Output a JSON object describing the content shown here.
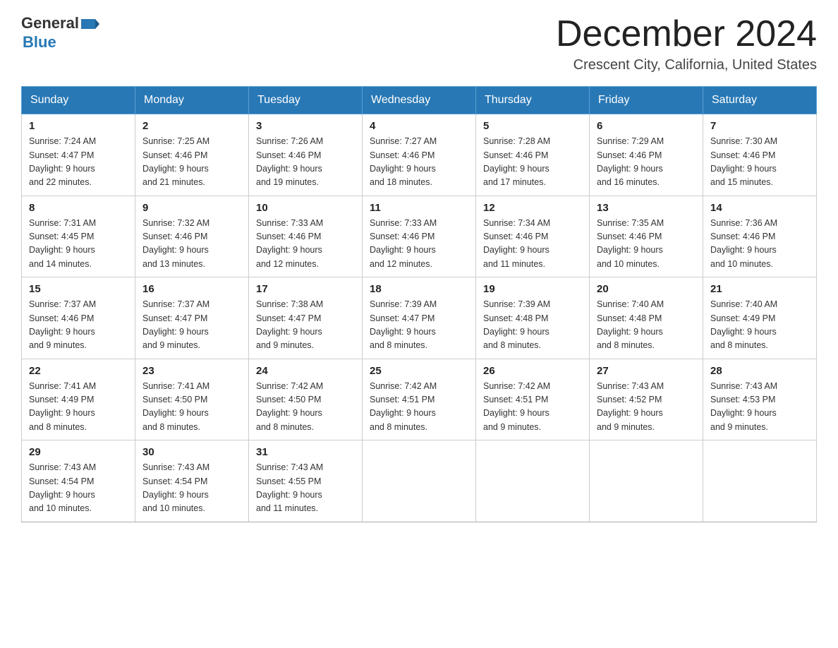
{
  "header": {
    "logo_general": "General",
    "logo_blue": "Blue",
    "month_title": "December 2024",
    "location": "Crescent City, California, United States"
  },
  "days_of_week": [
    "Sunday",
    "Monday",
    "Tuesday",
    "Wednesday",
    "Thursday",
    "Friday",
    "Saturday"
  ],
  "weeks": [
    [
      {
        "day": "1",
        "sunrise": "7:24 AM",
        "sunset": "4:47 PM",
        "daylight": "9 hours and 22 minutes."
      },
      {
        "day": "2",
        "sunrise": "7:25 AM",
        "sunset": "4:46 PM",
        "daylight": "9 hours and 21 minutes."
      },
      {
        "day": "3",
        "sunrise": "7:26 AM",
        "sunset": "4:46 PM",
        "daylight": "9 hours and 19 minutes."
      },
      {
        "day": "4",
        "sunrise": "7:27 AM",
        "sunset": "4:46 PM",
        "daylight": "9 hours and 18 minutes."
      },
      {
        "day": "5",
        "sunrise": "7:28 AM",
        "sunset": "4:46 PM",
        "daylight": "9 hours and 17 minutes."
      },
      {
        "day": "6",
        "sunrise": "7:29 AM",
        "sunset": "4:46 PM",
        "daylight": "9 hours and 16 minutes."
      },
      {
        "day": "7",
        "sunrise": "7:30 AM",
        "sunset": "4:46 PM",
        "daylight": "9 hours and 15 minutes."
      }
    ],
    [
      {
        "day": "8",
        "sunrise": "7:31 AM",
        "sunset": "4:45 PM",
        "daylight": "9 hours and 14 minutes."
      },
      {
        "day": "9",
        "sunrise": "7:32 AM",
        "sunset": "4:46 PM",
        "daylight": "9 hours and 13 minutes."
      },
      {
        "day": "10",
        "sunrise": "7:33 AM",
        "sunset": "4:46 PM",
        "daylight": "9 hours and 12 minutes."
      },
      {
        "day": "11",
        "sunrise": "7:33 AM",
        "sunset": "4:46 PM",
        "daylight": "9 hours and 12 minutes."
      },
      {
        "day": "12",
        "sunrise": "7:34 AM",
        "sunset": "4:46 PM",
        "daylight": "9 hours and 11 minutes."
      },
      {
        "day": "13",
        "sunrise": "7:35 AM",
        "sunset": "4:46 PM",
        "daylight": "9 hours and 10 minutes."
      },
      {
        "day": "14",
        "sunrise": "7:36 AM",
        "sunset": "4:46 PM",
        "daylight": "9 hours and 10 minutes."
      }
    ],
    [
      {
        "day": "15",
        "sunrise": "7:37 AM",
        "sunset": "4:46 PM",
        "daylight": "9 hours and 9 minutes."
      },
      {
        "day": "16",
        "sunrise": "7:37 AM",
        "sunset": "4:47 PM",
        "daylight": "9 hours and 9 minutes."
      },
      {
        "day": "17",
        "sunrise": "7:38 AM",
        "sunset": "4:47 PM",
        "daylight": "9 hours and 9 minutes."
      },
      {
        "day": "18",
        "sunrise": "7:39 AM",
        "sunset": "4:47 PM",
        "daylight": "9 hours and 8 minutes."
      },
      {
        "day": "19",
        "sunrise": "7:39 AM",
        "sunset": "4:48 PM",
        "daylight": "9 hours and 8 minutes."
      },
      {
        "day": "20",
        "sunrise": "7:40 AM",
        "sunset": "4:48 PM",
        "daylight": "9 hours and 8 minutes."
      },
      {
        "day": "21",
        "sunrise": "7:40 AM",
        "sunset": "4:49 PM",
        "daylight": "9 hours and 8 minutes."
      }
    ],
    [
      {
        "day": "22",
        "sunrise": "7:41 AM",
        "sunset": "4:49 PM",
        "daylight": "9 hours and 8 minutes."
      },
      {
        "day": "23",
        "sunrise": "7:41 AM",
        "sunset": "4:50 PM",
        "daylight": "9 hours and 8 minutes."
      },
      {
        "day": "24",
        "sunrise": "7:42 AM",
        "sunset": "4:50 PM",
        "daylight": "9 hours and 8 minutes."
      },
      {
        "day": "25",
        "sunrise": "7:42 AM",
        "sunset": "4:51 PM",
        "daylight": "9 hours and 8 minutes."
      },
      {
        "day": "26",
        "sunrise": "7:42 AM",
        "sunset": "4:51 PM",
        "daylight": "9 hours and 9 minutes."
      },
      {
        "day": "27",
        "sunrise": "7:43 AM",
        "sunset": "4:52 PM",
        "daylight": "9 hours and 9 minutes."
      },
      {
        "day": "28",
        "sunrise": "7:43 AM",
        "sunset": "4:53 PM",
        "daylight": "9 hours and 9 minutes."
      }
    ],
    [
      {
        "day": "29",
        "sunrise": "7:43 AM",
        "sunset": "4:54 PM",
        "daylight": "9 hours and 10 minutes."
      },
      {
        "day": "30",
        "sunrise": "7:43 AM",
        "sunset": "4:54 PM",
        "daylight": "9 hours and 10 minutes."
      },
      {
        "day": "31",
        "sunrise": "7:43 AM",
        "sunset": "4:55 PM",
        "daylight": "9 hours and 11 minutes."
      },
      null,
      null,
      null,
      null
    ]
  ],
  "labels": {
    "sunrise": "Sunrise:",
    "sunset": "Sunset:",
    "daylight": "Daylight:"
  }
}
